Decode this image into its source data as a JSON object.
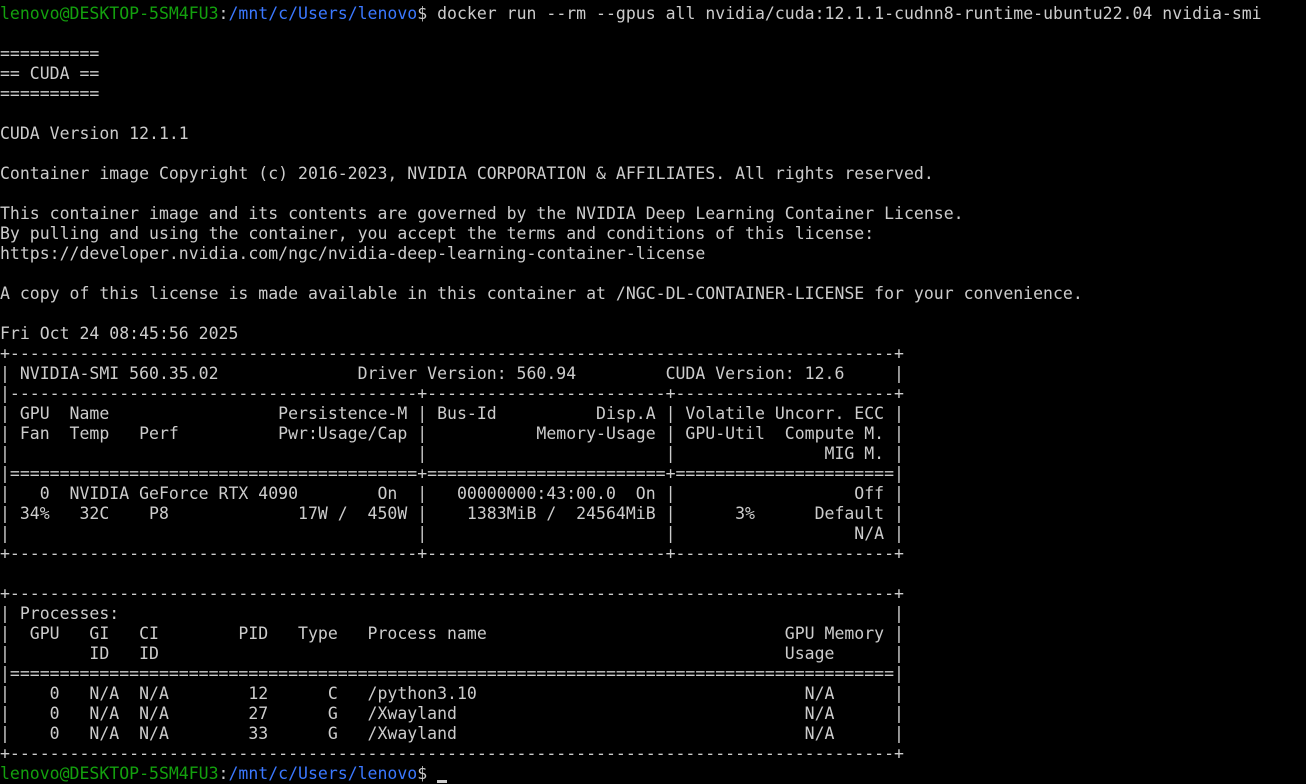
{
  "colors": {
    "background": "#000000",
    "foreground": "#cccccc",
    "user_host": "#13a10e",
    "path": "#3b78ff"
  },
  "prompt": {
    "user_host": "lenovo@DESKTOP-5SM4FU3",
    "separator": ":",
    "path": "/mnt/c/Users/lenovo",
    "symbol": "$ ",
    "command": "docker run --rm --gpus all nvidia/cuda:12.1.1-cudnn8-runtime-ubuntu22.04 nvidia-smi"
  },
  "banner": {
    "rule": "==========",
    "title": "== CUDA ==",
    "cuda_version": "CUDA Version 12.1.1",
    "copyright": "Container image Copyright (c) 2016-2023, NVIDIA CORPORATION & AFFILIATES. All rights reserved.",
    "license_1": "This container image and its contents are governed by the NVIDIA Deep Learning Container License.",
    "license_2": "By pulling and using the container, you accept the terms and conditions of this license:",
    "license_url": "https://developer.nvidia.com/ngc/nvidia-deep-learning-container-license",
    "license_copy": "A copy of this license is made available in this container at /NGC-DL-CONTAINER-LICENSE for your convenience.",
    "timestamp": "Fri Oct 24 08:45:56 2025"
  },
  "smi": {
    "border_top": "+-----------------------------------------------------------------------------------------+",
    "header_line": "| NVIDIA-SMI 560.35.02              Driver Version: 560.94         CUDA Version: 12.6     |",
    "sep_dash": "|-----------------------------------------+------------------------+----------------------+",
    "col_header_1": "| GPU  Name                 Persistence-M | Bus-Id          Disp.A | Volatile Uncorr. ECC |",
    "col_header_2": "| Fan  Temp   Perf          Pwr:Usage/Cap |           Memory-Usage | GPU-Util  Compute M. |",
    "col_header_3": "|                                         |                        |               MIG M. |",
    "sep_equals": "|=========================================+========================+======================|",
    "gpu_row_1": "|   0  NVIDIA GeForce RTX 4090        On  |   00000000:43:00.0  On |                  Off |",
    "gpu_row_2": "| 34%   32C    P8             17W /  450W |    1383MiB /  24564MiB |      3%      Default |",
    "gpu_row_3": "|                                         |                        |                  N/A |",
    "border_bottom": "+-----------------------------------------+------------------------+----------------------+",
    "blank": "",
    "proc_top": "+-----------------------------------------------------------------------------------------+",
    "proc_title": "| Processes:                                                                              |",
    "proc_header_1": "|  GPU   GI   CI        PID   Type   Process name                              GPU Memory |",
    "proc_header_2": "|        ID   ID                                                               Usage      |",
    "proc_sep": "|=========================================================================================|",
    "proc_row_1": "|    0   N/A  N/A        12      C   /python3.10                                 N/A      |",
    "proc_row_2": "|    0   N/A  N/A        27      G   /Xwayland                                   N/A      |",
    "proc_row_3": "|    0   N/A  N/A        33      G   /Xwayland                                   N/A      |",
    "proc_bottom": "+-----------------------------------------------------------------------------------------+"
  },
  "final_prompt": {
    "user_host": "lenovo@DESKTOP-5SM4FU3",
    "separator": ":",
    "path": "/mnt/c/Users/lenovo",
    "symbol": "$ "
  }
}
